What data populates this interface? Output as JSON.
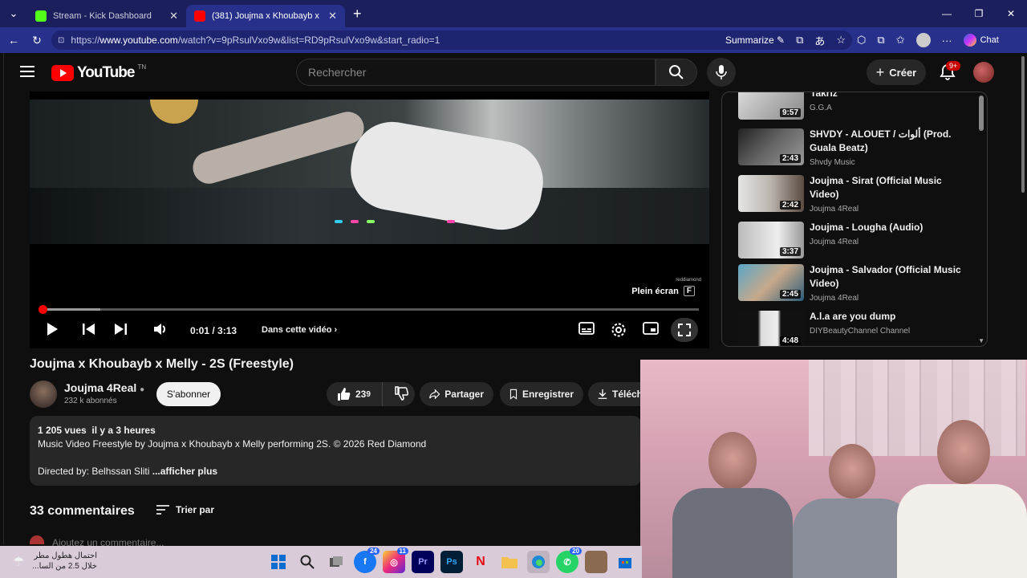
{
  "browser": {
    "tabs": [
      {
        "title": "Stream - Kick Dashboard",
        "active": false
      },
      {
        "title": "(381) Joujma x Khoubayb x Melly",
        "active": true
      }
    ],
    "url_prefix": "https://",
    "url_domain": "www.youtube.com",
    "url_path": "/watch?v=9pRsulVxo9w&list=RD9pRsulVxo9w&start_radio=1",
    "summarize": "Summarize",
    "chat": "Chat"
  },
  "header": {
    "logo": "YouTube",
    "country": "TN",
    "search_placeholder": "Rechercher",
    "create": "Créer",
    "notif_count": "9+"
  },
  "player": {
    "watermark": "reddiamond",
    "fullscreen_tip": "Plein écran",
    "fullscreen_key": "F",
    "time": "0:01 / 3:13",
    "playlist_label": "Dans cette vidéo",
    "progress_fraction": 0.001,
    "buffered_fraction": 0.09
  },
  "video": {
    "title": "Joujma x Khoubayb x Melly - 2S (Freestyle)",
    "channel": "Joujma 4Real",
    "subscribers": "232 k abonnés",
    "subscribe": "S'abonner",
    "likes": "23",
    "likes_sub": "9",
    "share": "Partager",
    "save": "Enregistrer",
    "download": "Téléch"
  },
  "description": {
    "stats": "1 205 vues  il y a 3 heures",
    "line1": "Music Video Freestyle by Joujma x Khoubayb x Melly performing 2S. © 2026 Red Diamond",
    "line2": "Directed by: Belhssan Sliti",
    "more": " ...afficher plus"
  },
  "comments": {
    "count": "33 commentaires",
    "sort": "Trier par",
    "add": "Ajoutez un commentaire..."
  },
  "sidebar": {
    "cut_title": "Takriz",
    "items": [
      {
        "title": "",
        "channel": "G.G.A",
        "duration": "9:57"
      },
      {
        "title": "SHVDY - ALOUET / ألوات (Prod. Guala Beatz)",
        "channel": "Shvdy Music",
        "duration": "2:43"
      },
      {
        "title": "Joujma - Sirat (Official Music Video)",
        "channel": "Joujma 4Real",
        "duration": "2:42"
      },
      {
        "title": "Joujma - Lougha (Audio)",
        "channel": "Joujma 4Real",
        "duration": "3:37"
      },
      {
        "title": "Joujma - Salvador (Official Music Video)",
        "channel": "Joujma 4Real",
        "duration": "2:45"
      },
      {
        "title": "A.l.a are you dump",
        "channel": "DIYBeautyChannel Channel",
        "duration": "4:48"
      }
    ]
  },
  "taskbar": {
    "weather_line1": "احتمال هطول مطر",
    "weather_line2": "خلال 2.5 من السا...",
    "badges": {
      "facebook": "24",
      "instagram": "11",
      "whatsapp": "20"
    }
  }
}
